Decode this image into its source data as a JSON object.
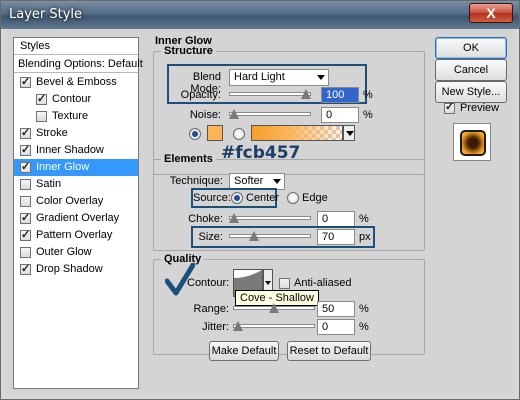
{
  "window": {
    "title": "Layer Style",
    "close_label": "X"
  },
  "styles_list": {
    "header": "Styles",
    "blending": "Blending Options: Default",
    "items": [
      {
        "label": "Bevel & Emboss",
        "checked": true,
        "indent": false
      },
      {
        "label": "Contour",
        "checked": true,
        "indent": true
      },
      {
        "label": "Texture",
        "checked": false,
        "indent": true
      },
      {
        "label": "Stroke",
        "checked": true,
        "indent": false
      },
      {
        "label": "Inner Shadow",
        "checked": true,
        "indent": false
      },
      {
        "label": "Inner Glow",
        "checked": true,
        "indent": false,
        "selected": true
      },
      {
        "label": "Satin",
        "checked": false,
        "indent": false
      },
      {
        "label": "Color Overlay",
        "checked": false,
        "indent": false
      },
      {
        "label": "Gradient Overlay",
        "checked": true,
        "indent": false
      },
      {
        "label": "Pattern Overlay",
        "checked": true,
        "indent": false
      },
      {
        "label": "Outer Glow",
        "checked": false,
        "indent": false
      },
      {
        "label": "Drop Shadow",
        "checked": true,
        "indent": false
      }
    ]
  },
  "inner_glow": {
    "title": "Inner Glow",
    "structure": {
      "title": "Structure",
      "blend_mode_label": "Blend Mode:",
      "blend_mode_value": "Hard Light",
      "opacity_label": "Opacity:",
      "opacity_value": "100",
      "opacity_level": 1.0,
      "noise_label": "Noise:",
      "noise_value": "0",
      "noise_level": 0.0,
      "percent": "%",
      "glow_color": "#fcb457"
    },
    "annotation_hex": "#fcb457",
    "elements": {
      "title": "Elements",
      "technique_label": "Technique:",
      "technique_value": "Softer",
      "source_label": "Source:",
      "source_center": "Center",
      "source_edge": "Edge",
      "choke_label": "Choke:",
      "choke_value": "0",
      "choke_level": 0.0,
      "size_label": "Size:",
      "size_value": "70",
      "size_level": 0.28,
      "px": "px",
      "percent": "%"
    },
    "quality": {
      "title": "Quality",
      "contour_label": "Contour:",
      "anti_aliased_label": "Anti-aliased",
      "tooltip": "Cove - Shallow",
      "range_label": "Range:",
      "range_value": "50",
      "range_level": 0.5,
      "jitter_label": "Jitter:",
      "jitter_value": "0",
      "jitter_level": 0.0,
      "percent": "%"
    },
    "make_default": "Make Default",
    "reset_default": "Reset to Default"
  },
  "right_buttons": {
    "ok": "OK",
    "cancel": "Cancel",
    "new_style": "New Style...",
    "preview_label": "Preview"
  },
  "colors": {
    "accent": "#3399ff",
    "annotation_blue": "#1c4f7a",
    "glow": "#fcb457"
  }
}
